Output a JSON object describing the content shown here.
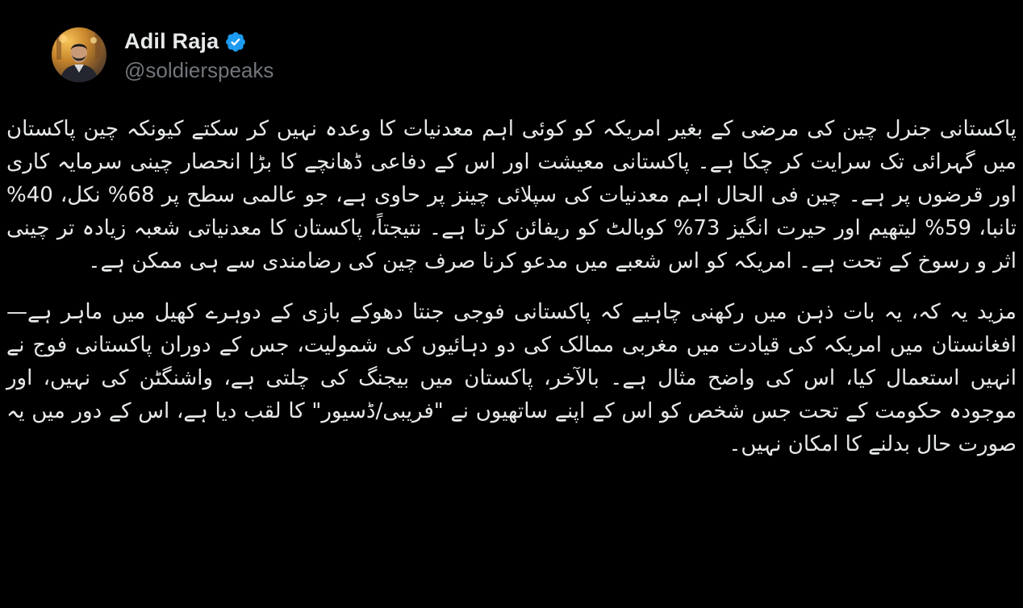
{
  "tweet": {
    "author": {
      "name": "Adil Raja",
      "handle": "@soldierspeaks",
      "avatar_icon": "profile-photo",
      "verified_icon": "verified-badge-icon",
      "verified_color": "#1d9bf0"
    },
    "paragraphs": [
      "پاکستانی جنرل چین کی مرضی کے بغیر امریکہ کو کوئی اہم معدنیات کا وعدہ نہیں کر سکتے کیونکہ چین پاکستان میں گہرائی تک سرایت کر چکا ہے۔ پاکستانی معیشت اور اس کے دفاعی ڈھانچے کا بڑا انحصار چینی سرمایہ کاری اور قرضوں پر ہے۔ چین فی الحال اہم معدنیات کی سپلائی چینز پر حاوی ہے، جو عالمی سطح پر 68% نکل، 40% تانبا، 59% لیتھیم اور حیرت انگیز 73% کوبالٹ کو ریفائن کرتا ہے۔ نتیجتاً، پاکستان کا معدنیاتی شعبہ زیادہ تر چینی اثر و رسوخ کے تحت ہے۔ امریکہ کو اس شعبے میں مدعو کرنا صرف چین کی رضامندی سے ہی ممکن ہے۔",
      "مزید یہ کہ، یہ بات ذہن میں رکھنی چاہیے کہ پاکستانی فوجی جنتا دھوکے بازی کے دوہرے کھیل میں ماہر ہے—افغانستان میں امریکہ کی قیادت میں مغربی ممالک کی دو دہائیوں کی شمولیت، جس کے دوران پاکستانی فوج نے انہیں استعمال کیا، اس کی واضح مثال ہے۔ بالآخر، پاکستان میں بیجنگ کی چلتی ہے، واشنگٹن کی نہیں، اور موجودہ حکومت کے تحت جس شخص کو اس کے اپنے ساتھیوں نے \"فریبی/ڈسیور\" کا لقب دیا ہے، اس کے دور میں یہ صورت حال بدلنے کا امکان نہیں۔"
    ]
  }
}
